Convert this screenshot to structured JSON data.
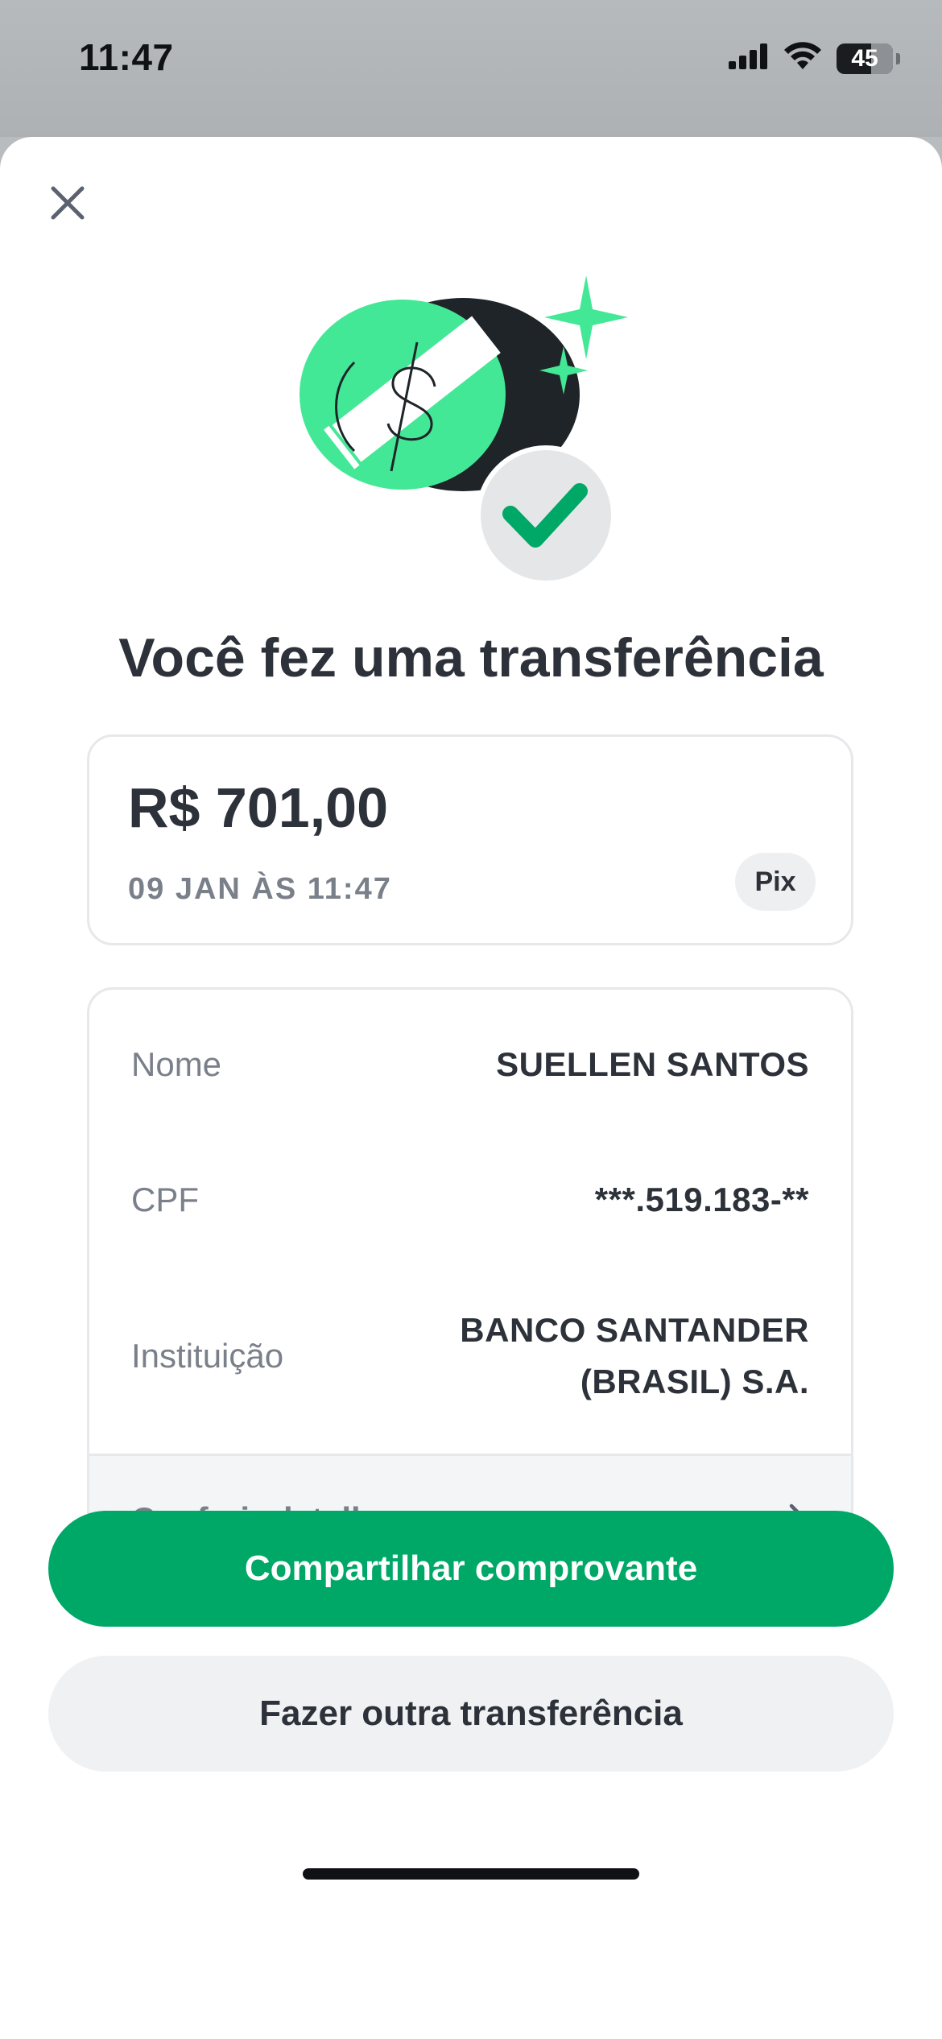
{
  "status_bar": {
    "time": "11:47",
    "battery": "45"
  },
  "title": "Você fez uma transferência",
  "amount_card": {
    "amount": "R$ 701,00",
    "date": "09 JAN ÀS 11:47",
    "badge": "Pix"
  },
  "details": {
    "rows": [
      {
        "label": "Nome",
        "value": "SUELLEN SANTOS"
      },
      {
        "label": "CPF",
        "value": "***.519.183-**"
      },
      {
        "label": "Instituição",
        "value_line1": "BANCO SANTANDER",
        "value_line2": "(BRASIL) S.A."
      }
    ],
    "footer_label": "Conferir detalhes"
  },
  "buttons": {
    "primary": "Compartilhar comprovante",
    "secondary": "Fazer outra transferência"
  },
  "colors": {
    "accent_green": "#00a868",
    "illustration_green": "#43e896",
    "text_dark": "#2d323a",
    "text_muted": "#7a808a"
  },
  "icons": {
    "close": "close-icon",
    "chevron": "chevron-right-icon",
    "success": "check-icon",
    "illustration": "money-transfer-icon"
  }
}
